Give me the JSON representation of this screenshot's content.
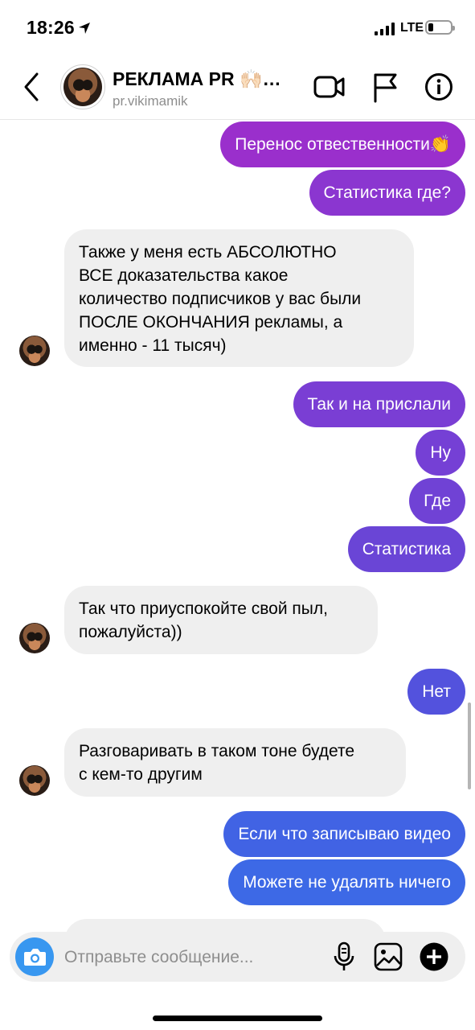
{
  "status": {
    "time": "18:26",
    "network": "LTE"
  },
  "header": {
    "name": "РЕКЛАМА PR 🙌🏻…",
    "username": "pr.vikimamik"
  },
  "messages": [
    {
      "text": "Перенос отвественности👏"
    },
    {
      "text": "Статистика где?"
    },
    {
      "lines": [
        "Также у меня есть АБСОЛЮТНО",
        "ВСЕ доказательства какое",
        "количество подписчиков у вас были",
        "ПОСЛЕ ОКОНЧАНИЯ рекламы, а",
        "именно -  11 тысяч)"
      ]
    },
    {
      "text": "Так и на прислали"
    },
    {
      "text": "Ну"
    },
    {
      "text": "Где"
    },
    {
      "text": "Статистика"
    },
    {
      "lines": [
        "Так что приуспокойте свой пыл,",
        "пожалуйста))"
      ]
    },
    {
      "text": "Нет"
    },
    {
      "lines": [
        "Разговаривать в таком тоне будете",
        "с кем-то другим"
      ]
    },
    {
      "text": "Если что записываю видео"
    },
    {
      "text": "Можете не удалять ничего"
    }
  ],
  "composer": {
    "placeholder": "Отправьте сообщение..."
  },
  "colors": {
    "gradient_top": "#9b2fcb",
    "gradient_mid": "#6a44d6",
    "gradient_bottom": "#3d6ae6",
    "incoming_bg": "#efefef",
    "camera_blue": "#3897f0"
  },
  "icons": [
    "back-chevron-icon",
    "video-call-icon",
    "flag-icon",
    "info-icon",
    "camera-icon",
    "microphone-icon",
    "gallery-icon",
    "plus-circle-icon"
  ]
}
